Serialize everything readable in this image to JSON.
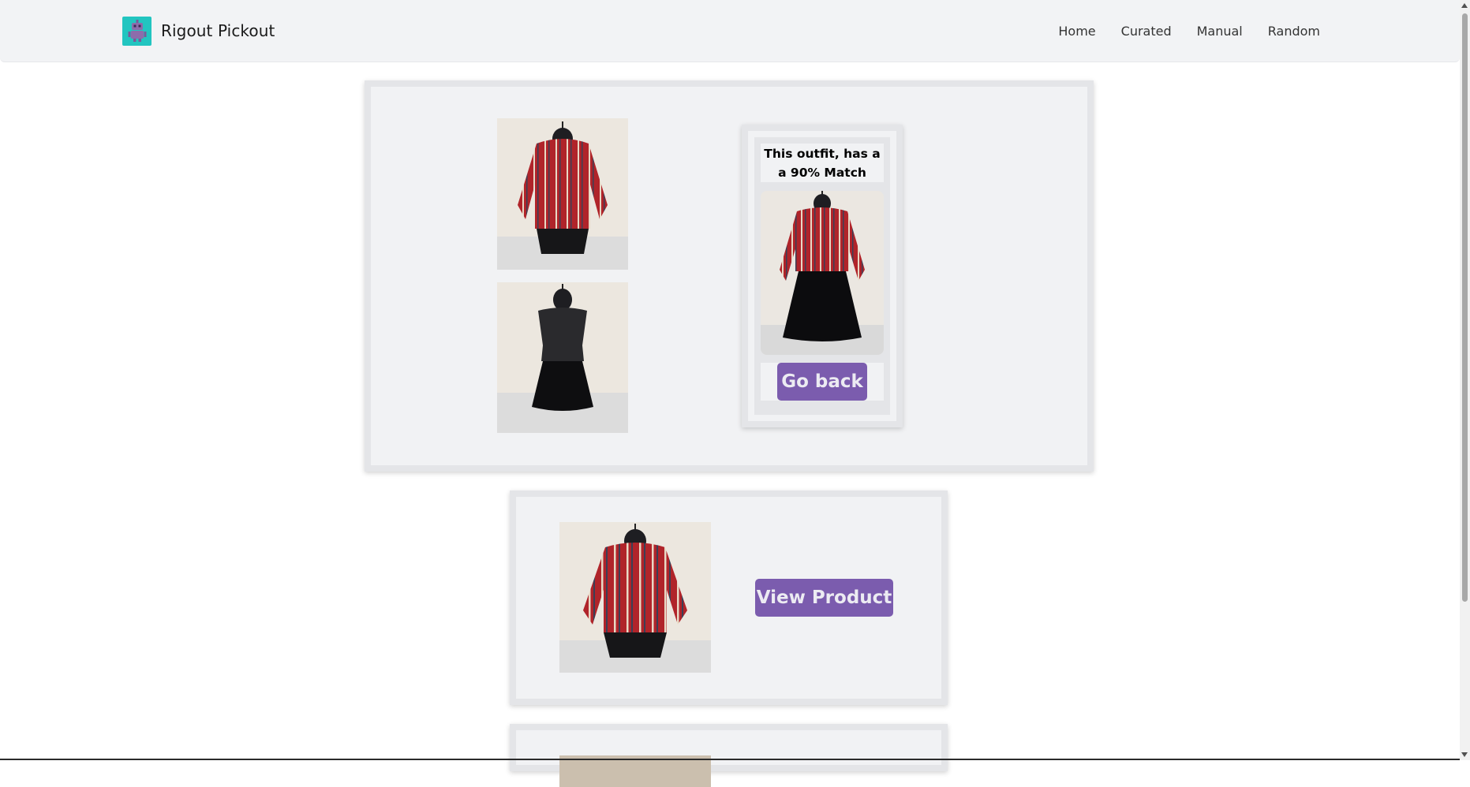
{
  "navbar": {
    "brand_name": "Rigout Pickout",
    "brand_logo_icon": "robot-icon",
    "links": [
      {
        "label": "Home"
      },
      {
        "label": "Curated"
      },
      {
        "label": "Manual"
      },
      {
        "label": "Random"
      }
    ]
  },
  "outfit": {
    "items": [
      {
        "kind": "top",
        "image_icon": "striped-off-shoulder-top-photo"
      },
      {
        "kind": "skirt",
        "image_icon": "black-skirt-photo"
      }
    ],
    "match": {
      "text": "This outfit, has a a 90% Match",
      "image_icon": "combined-outfit-photo",
      "go_back_label": "Go back"
    }
  },
  "products": [
    {
      "image_icon": "striped-off-shoulder-top-photo",
      "button_label": "View Product"
    },
    {
      "image_icon": "product-photo-partial"
    }
  ],
  "colors": {
    "accent": "#7b5cae",
    "nav_bg": "#f2f3f5",
    "card_border": "#e4e5e8",
    "card_bg": "#f1f2f4",
    "logo_bg": "#22c5c0"
  }
}
